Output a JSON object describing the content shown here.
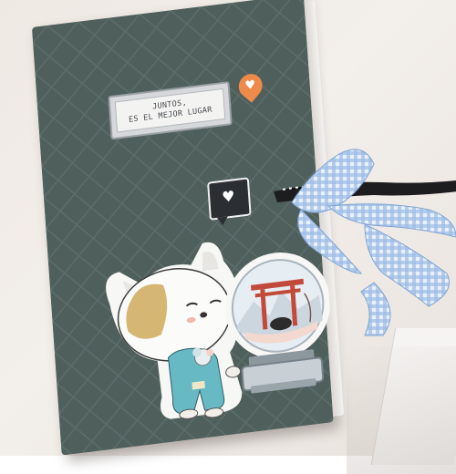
{
  "scene": {
    "label_lines": [
      "JUNTOS,",
      "ES EL MEJOR LUGAR"
    ],
    "icons": {
      "orange_bubble": "heart-speech-bubble-icon",
      "black_bubble": "heart-speech-bubble-icon",
      "heart_glyph": "♥"
    },
    "colors": {
      "cover": "#4f5f5c",
      "orange": "#ee8a4a",
      "gingham": "#8fb2de",
      "black_ribbon": "#1d1d1f"
    }
  }
}
